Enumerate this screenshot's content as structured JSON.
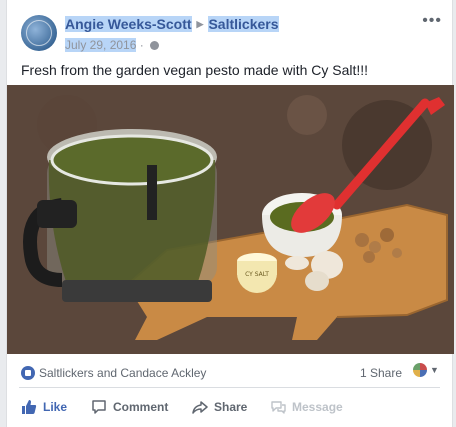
{
  "post": {
    "author": "Angie Weeks-Scott",
    "group": "Saltlickers",
    "date": "July 29, 2016",
    "separator": "·",
    "text": "Fresh from the garden vegan pesto made with Cy Salt!!!",
    "jar_label": "CY SALT"
  },
  "reactions": {
    "names": "Saltlickers and Candace Ackley",
    "shares": "1 Share"
  },
  "actions": {
    "like": "Like",
    "comment": "Comment",
    "share": "Share",
    "message": "Message"
  },
  "colors": {
    "link": "#365899",
    "like_active": "#4267b2",
    "muted": "#90949c",
    "disabled": "#bec3c9"
  }
}
